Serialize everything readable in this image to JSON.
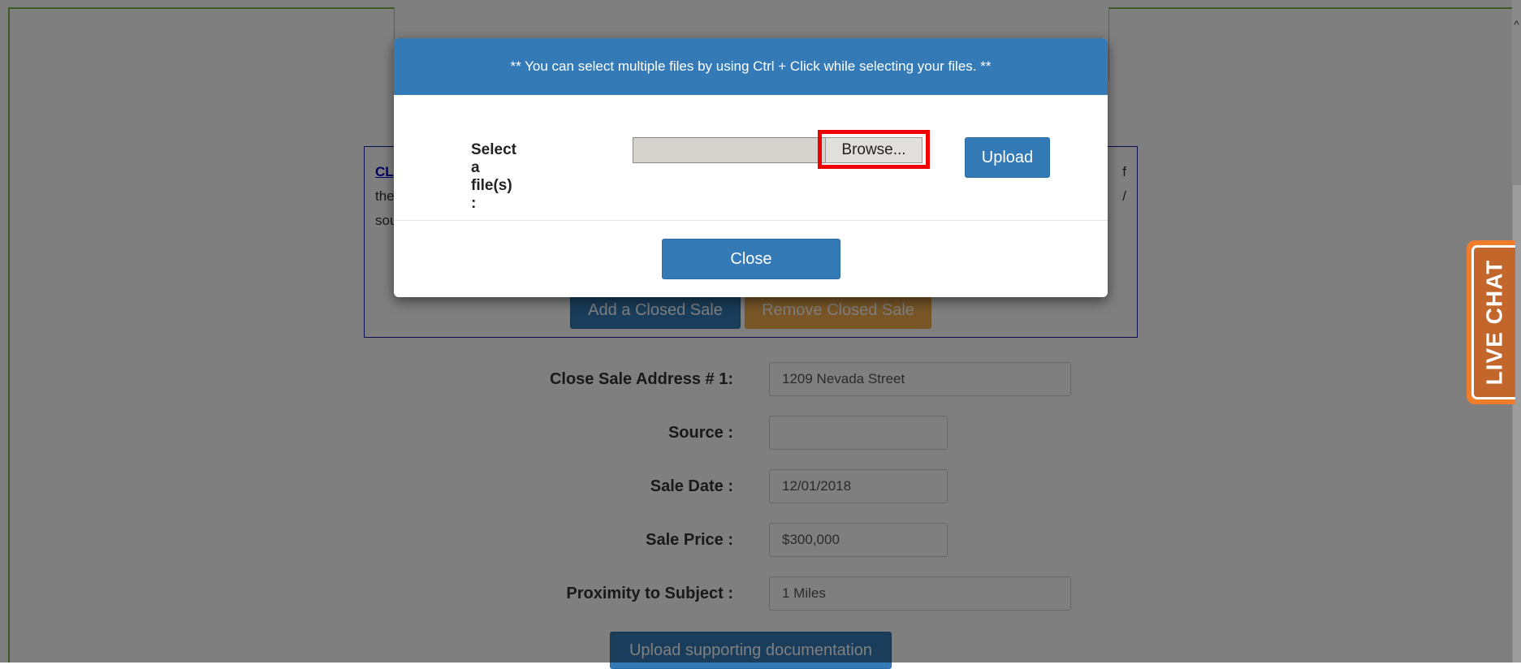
{
  "background": {
    "closed_sale_text_line1": "CL",
    "closed_sale_text_line2": "the",
    "closed_sale_text_line3": "sou",
    "right_edge_char_1": "f",
    "right_edge_char_2": "/",
    "add_closed_sale": "Add a Closed Sale",
    "remove_closed_sale": "Remove Closed Sale",
    "form": [
      {
        "label": "Close Sale Address # 1:",
        "value": "1209 Nevada Street",
        "wide": true
      },
      {
        "label": "Source :",
        "value": "",
        "wide": false
      },
      {
        "label": "Sale Date :",
        "value": "12/01/2018",
        "wide": false
      },
      {
        "label": "Sale Price :",
        "value": "$300,000",
        "wide": false
      },
      {
        "label": "Proximity to Subject :",
        "value": "1 Miles",
        "wide": true
      }
    ],
    "upload_supporting": "Upload supporting documentation"
  },
  "live_chat": {
    "label": "LIVE CHAT",
    "color": "#f07d2c"
  },
  "modal": {
    "header_text": "** You can select multiple files by using Ctrl + Click while selecting your files. **",
    "select_label": "Select a file(s) :",
    "browse_label": "Browse...",
    "upload_label": "Upload",
    "close_label": "Close",
    "accent_color": "#337ab7",
    "highlight_color": "#ee0000"
  }
}
